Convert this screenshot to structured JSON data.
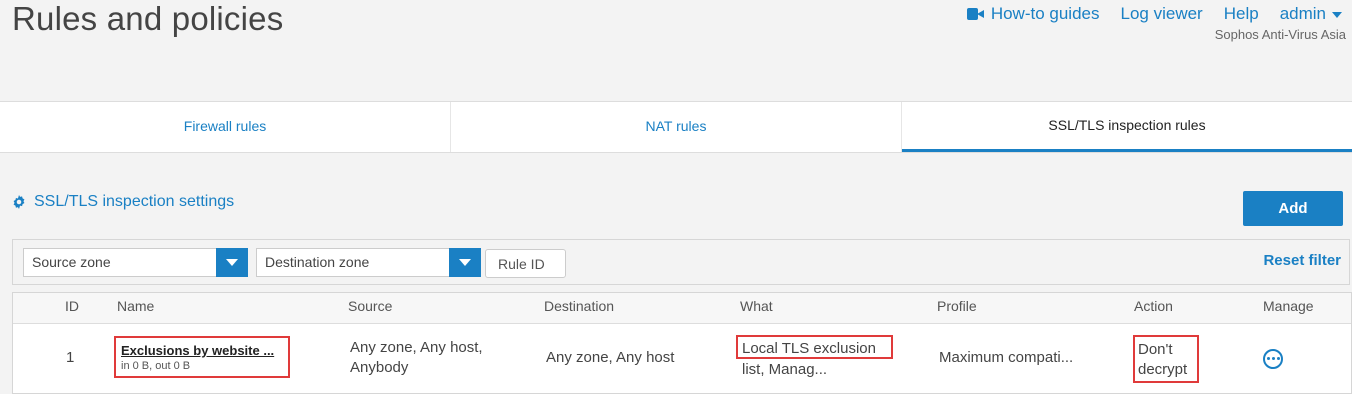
{
  "page": {
    "title": "Rules and policies"
  },
  "header": {
    "howto_label": "How-to guides",
    "logviewer_label": "Log viewer",
    "help_label": "Help",
    "admin_label": "admin",
    "org_name": "Sophos Anti-Virus Asia"
  },
  "tabs": [
    {
      "label": "Firewall rules",
      "active": false
    },
    {
      "label": "NAT rules",
      "active": false
    },
    {
      "label": "SSL/TLS inspection rules",
      "active": true
    }
  ],
  "settings_link": "SSL/TLS inspection settings",
  "add_button": "Add",
  "filters": {
    "source_zone": "Source zone",
    "destination_zone": "Destination zone",
    "rule_id_placeholder": "Rule ID",
    "reset_label": "Reset filter"
  },
  "table": {
    "columns": [
      "ID",
      "Name",
      "Source",
      "Destination",
      "What",
      "Profile",
      "Action",
      "Manage"
    ],
    "rows": [
      {
        "id": "1",
        "name": "Exclusions by website ...",
        "traffic": "in 0 B, out 0 B",
        "source_line1": "Any zone, Any host,",
        "source_line2": "Anybody",
        "destination": "Any zone, Any host",
        "what_line1": "Local TLS exclusion",
        "what_line2": "list, Manag...",
        "profile": "Maximum compati...",
        "action_line1": "Don't",
        "action_line2": "decrypt"
      }
    ]
  },
  "colors": {
    "accent": "#1a80c4",
    "highlight": "#e03a3a"
  }
}
